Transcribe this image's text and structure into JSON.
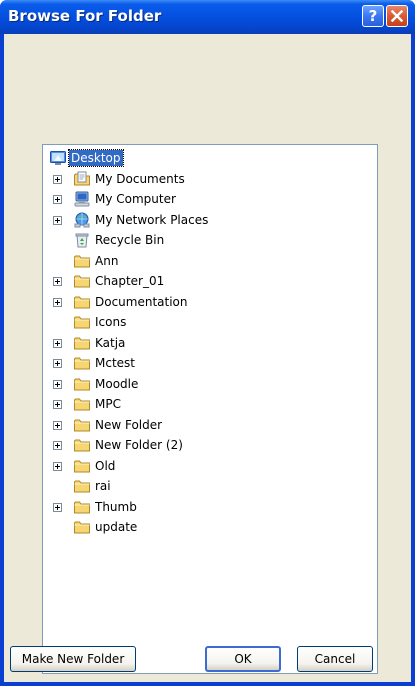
{
  "window": {
    "title": "Browse For Folder",
    "help_label": "?"
  },
  "tree": {
    "items": [
      {
        "label": "Desktop",
        "icon": "desktop-icon",
        "expander": false,
        "level": 0,
        "selected": true
      },
      {
        "label": "My Documents",
        "icon": "my-documents-icon",
        "expander": true,
        "level": 1
      },
      {
        "label": "My Computer",
        "icon": "my-computer-icon",
        "expander": true,
        "level": 1
      },
      {
        "label": "My Network Places",
        "icon": "network-places-icon",
        "expander": true,
        "level": 1
      },
      {
        "label": "Recycle Bin",
        "icon": "recycle-bin-icon",
        "expander": false,
        "level": 1
      },
      {
        "label": "Ann",
        "icon": "folder-icon",
        "expander": false,
        "level": 1
      },
      {
        "label": "Chapter_01",
        "icon": "folder-icon",
        "expander": true,
        "level": 1
      },
      {
        "label": "Documentation",
        "icon": "folder-icon",
        "expander": true,
        "level": 1
      },
      {
        "label": "Icons",
        "icon": "folder-icon",
        "expander": false,
        "level": 1
      },
      {
        "label": "Katja",
        "icon": "folder-icon",
        "expander": true,
        "level": 1
      },
      {
        "label": "Mctest",
        "icon": "folder-icon",
        "expander": true,
        "level": 1
      },
      {
        "label": "Moodle",
        "icon": "folder-icon",
        "expander": true,
        "level": 1
      },
      {
        "label": "MPC",
        "icon": "folder-icon",
        "expander": true,
        "level": 1
      },
      {
        "label": "New Folder",
        "icon": "folder-icon",
        "expander": true,
        "level": 1
      },
      {
        "label": "New Folder (2)",
        "icon": "folder-icon",
        "expander": true,
        "level": 1
      },
      {
        "label": "Old",
        "icon": "folder-icon",
        "expander": true,
        "level": 1
      },
      {
        "label": "rai",
        "icon": "folder-icon",
        "expander": false,
        "level": 1
      },
      {
        "label": "Thumb",
        "icon": "folder-icon",
        "expander": true,
        "level": 1
      },
      {
        "label": "update",
        "icon": "folder-icon",
        "expander": false,
        "level": 1
      }
    ]
  },
  "buttons": {
    "make_new_folder": "Make New Folder",
    "ok": "OK",
    "cancel": "Cancel"
  },
  "colors": {
    "titlebar": "#0551e1",
    "dialog_face": "#ece9d8",
    "selection": "#316ac5",
    "close_button": "#d95b34",
    "folder": "#f4d26a"
  }
}
